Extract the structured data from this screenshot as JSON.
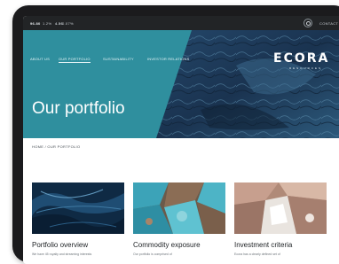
{
  "topbar": {
    "item1": "96.80",
    "item2": "1.2%",
    "item3": "4.56",
    "item4": "0.07%",
    "contact": "CONTACT"
  },
  "nav": {
    "items": [
      {
        "label": "ABOUT US"
      },
      {
        "label": "OUR PORTFOLIO"
      },
      {
        "label": "SUSTAINABILITY"
      },
      {
        "label": "INVESTOR RELATIONS"
      }
    ]
  },
  "logo": {
    "text": "ECORA",
    "subtitle": "RESOURCES"
  },
  "hero": {
    "title": "Our portfolio"
  },
  "breadcrumb": "HOME / OUR PORTFOLIO",
  "cards": [
    {
      "title": "Portfolio overview",
      "desc": "We have 45 royalty and streaming interests",
      "image": "dark-blue-rock"
    },
    {
      "title": "Commodity exposure",
      "desc": "Our portfolio is comprised of",
      "image": "turquoise-ore"
    },
    {
      "title": "Investment criteria",
      "desc": "Ecora has a clearly defined set of",
      "image": "crystal-ore"
    }
  ],
  "colors": {
    "hero_teal": "#2f8f9e",
    "hero_dark": "#1e3b55",
    "device": "#1b1b1d"
  }
}
